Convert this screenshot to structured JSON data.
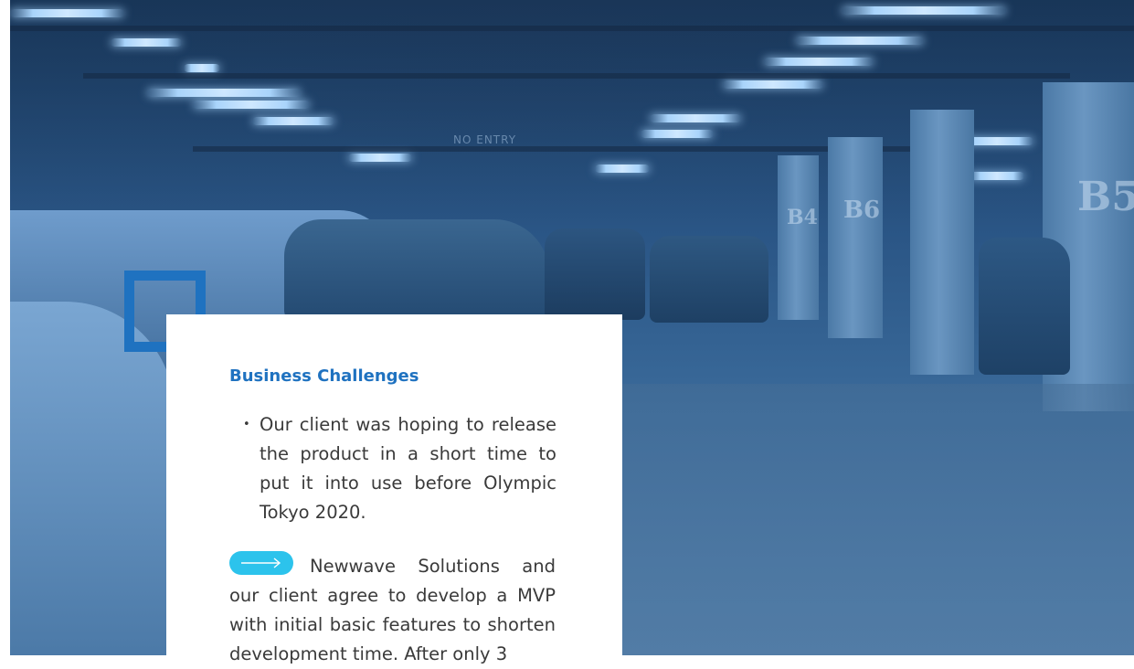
{
  "hero": {
    "sign_text": "NO ENTRY",
    "column_signs": [
      "B4",
      "B5",
      "B6"
    ]
  },
  "card": {
    "title": "Business Challenges",
    "bullets": [
      "Our client was hoping to release the product in a short time to put it into use before Olympic Tokyo 2020."
    ],
    "body": "Newwave Solutions and our client agree to develop a MVP with initial basic features to shorten development time. After only 3",
    "accent_color": "#1f72c0",
    "arrow_color": "#2cc3ec",
    "arrow_icon": "long-arrow-right-icon"
  }
}
